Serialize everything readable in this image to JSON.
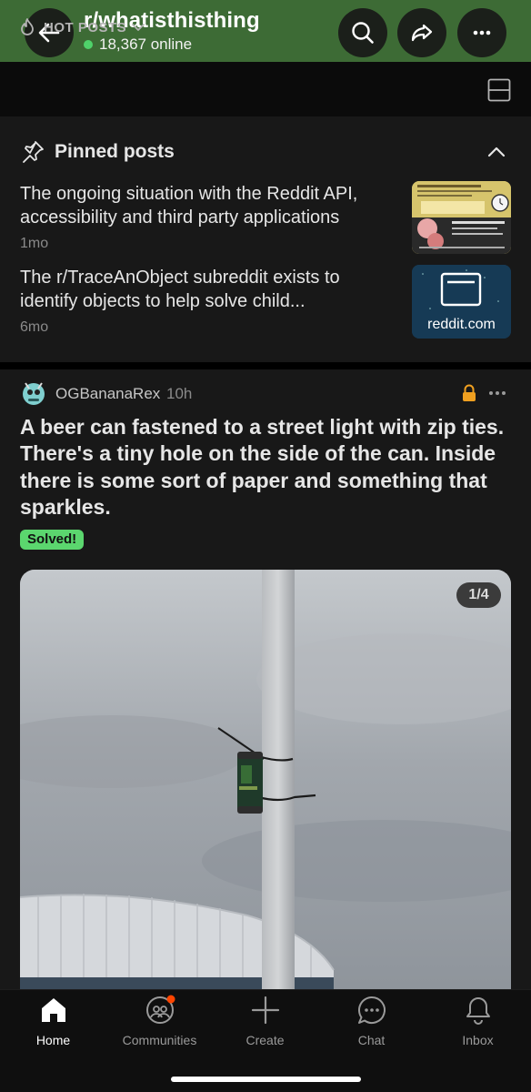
{
  "header": {
    "subreddit": "r/whatisthisthing",
    "online": "18,367 online",
    "accent": "#3d6b35",
    "icons": [
      "arrow-left-icon",
      "search-icon",
      "share-icon",
      "more-icon"
    ]
  },
  "sortbar": {
    "label": "HOT POSTS",
    "icons": [
      "flame-icon",
      "chevron-down-icon",
      "layout-icon"
    ]
  },
  "pinned": {
    "heading": "Pinned posts",
    "items": [
      {
        "title": "The ongoing situation with the Reddit API, accessibility and third party applications",
        "age": "1mo",
        "thumb": "screenshot-thumbnail"
      },
      {
        "title": "The r/TraceAnObject subreddit exists to identify objects to help solve child...",
        "age": "6mo",
        "thumb_domain": "reddit.com"
      }
    ]
  },
  "post": {
    "author": "OGBananaRex",
    "age": "10h",
    "title": "A beer can fastened to a street light with zip ties. There's a tiny hole on the side of the can. Inside there is some sort of paper and something that sparkles.",
    "flair": "Solved!",
    "flair_color": "#5bd66e",
    "image_counter": "1/4",
    "image_description_icon": "photo-beer-can-on-pole"
  },
  "nav": {
    "items": [
      {
        "label": "Home",
        "icon": "home-icon",
        "active": true
      },
      {
        "label": "Communities",
        "icon": "communities-icon",
        "active": false
      },
      {
        "label": "Create",
        "icon": "plus-icon",
        "active": false
      },
      {
        "label": "Chat",
        "icon": "chat-icon",
        "active": false
      },
      {
        "label": "Inbox",
        "icon": "bell-icon",
        "active": false
      }
    ]
  }
}
